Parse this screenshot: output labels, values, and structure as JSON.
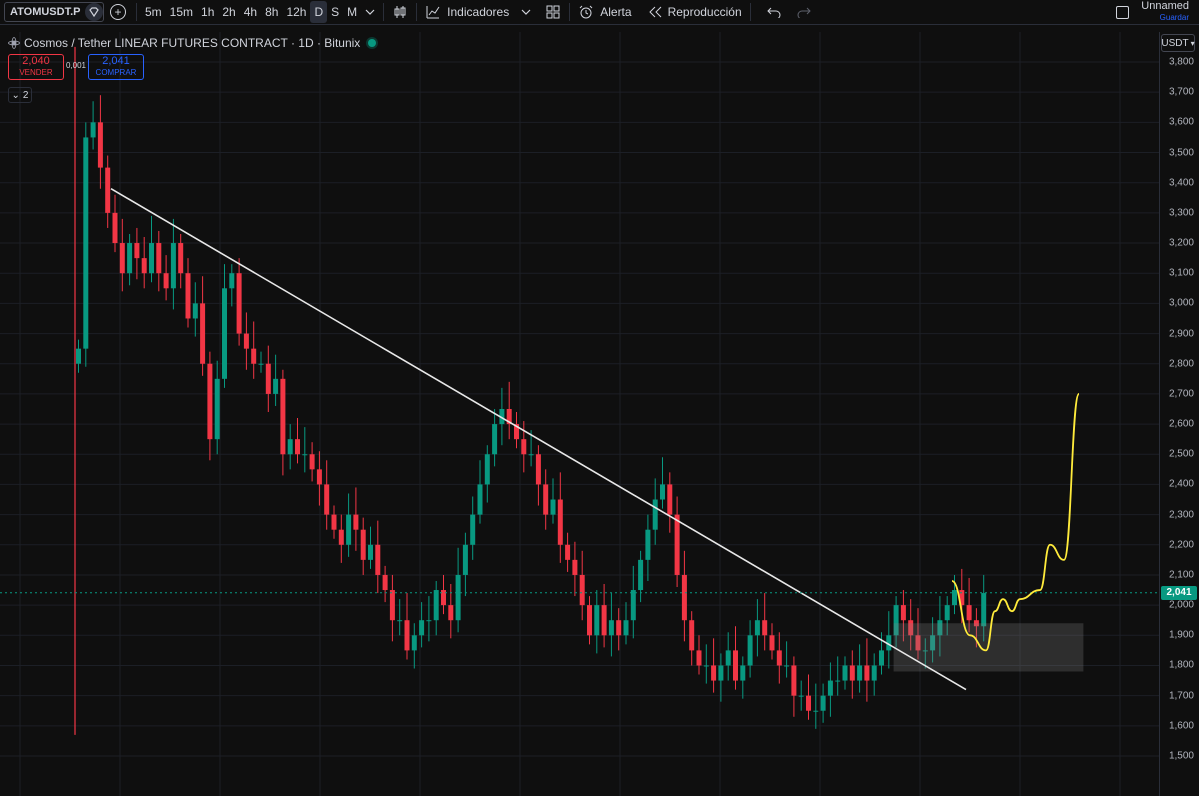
{
  "toolbar": {
    "symbol": "ATOMUSDT.P",
    "intervals": [
      "5m",
      "15m",
      "1h",
      "2h",
      "4h",
      "8h",
      "12h",
      "D",
      "S",
      "M"
    ],
    "active_interval": "D",
    "indicators_label": "Indicadores",
    "alert_label": "Alerta",
    "replay_label": "Reproducción",
    "layout_name": "Unnamed",
    "save_label": "Guardar"
  },
  "legend": {
    "title": "Cosmos / Tether LINEAR FUTURES CONTRACT · 1D · Bitunix"
  },
  "trade": {
    "sell_price": "2,040",
    "sell_label": "VENDER",
    "spread": "0,001",
    "buy_price": "2,041",
    "buy_label": "COMPRAR"
  },
  "indicators_collapsed": "2",
  "axis": {
    "currency": "USDT",
    "last_price": "2,041"
  },
  "colors": {
    "up": "#089981",
    "down": "#f23645",
    "trendline": "#e8e8e8",
    "projection": "#ffeb3b",
    "zone": "#808080"
  },
  "chart_data": {
    "type": "candlestick",
    "symbol": "ATOMUSDT.P",
    "timeframe": "1D",
    "exchange": "Bitunix",
    "ylim": [
      1.4,
      3.85
    ],
    "yticks": [
      "3,800",
      "3,700",
      "3,600",
      "3,500",
      "3,400",
      "3,300",
      "3,200",
      "3,100",
      "3,000",
      "2,900",
      "2,800",
      "2,700",
      "2,600",
      "2,500",
      "2,400",
      "2,300",
      "2,200",
      "2,100",
      "2,000",
      "1,900",
      "1,800",
      "1,700",
      "1,600",
      "1,500"
    ],
    "last_price": 2.041,
    "closes": [
      2.85,
      3.55,
      3.6,
      3.45,
      3.3,
      3.2,
      3.1,
      3.2,
      3.15,
      3.1,
      3.2,
      3.1,
      3.05,
      3.2,
      3.1,
      2.95,
      3.0,
      2.8,
      2.55,
      2.75,
      3.05,
      3.1,
      2.9,
      2.85,
      2.8,
      2.8,
      2.7,
      2.75,
      2.5,
      2.55,
      2.5,
      2.5,
      2.45,
      2.4,
      2.3,
      2.25,
      2.2,
      2.3,
      2.25,
      2.15,
      2.2,
      2.1,
      2.05,
      1.95,
      1.95,
      1.85,
      1.9,
      1.95,
      1.95,
      2.05,
      2.0,
      1.95,
      2.1,
      2.2,
      2.3,
      2.4,
      2.5,
      2.6,
      2.65,
      2.6,
      2.55,
      2.5,
      2.5,
      2.4,
      2.3,
      2.35,
      2.2,
      2.15,
      2.1,
      2.0,
      1.9,
      2.0,
      1.9,
      1.95,
      1.9,
      1.95,
      2.05,
      2.15,
      2.25,
      2.35,
      2.4,
      2.3,
      2.1,
      1.95,
      1.85,
      1.8,
      1.8,
      1.75,
      1.8,
      1.85,
      1.75,
      1.8,
      1.9,
      1.95,
      1.9,
      1.85,
      1.8,
      1.8,
      1.7,
      1.7,
      1.65,
      1.65,
      1.7,
      1.75,
      1.75,
      1.8,
      1.75,
      1.8,
      1.75,
      1.8,
      1.85,
      1.9,
      2.0,
      1.95,
      1.9,
      1.85,
      1.85,
      1.9,
      1.95,
      2.0,
      2.05,
      2.0,
      1.95,
      1.93,
      2.04
    ],
    "trendline": {
      "from": {
        "bar": 3,
        "price": 3.38
      },
      "to": {
        "bar": 118,
        "price": 1.72
      }
    },
    "zone": {
      "from_bar": 112,
      "to_bar": 138,
      "low": 1.78,
      "high": 1.94
    },
    "projection": [
      2.08,
      1.9,
      1.85,
      1.98,
      2.02,
      1.98,
      2.02,
      2.05,
      2.2,
      2.15,
      2.7
    ]
  }
}
